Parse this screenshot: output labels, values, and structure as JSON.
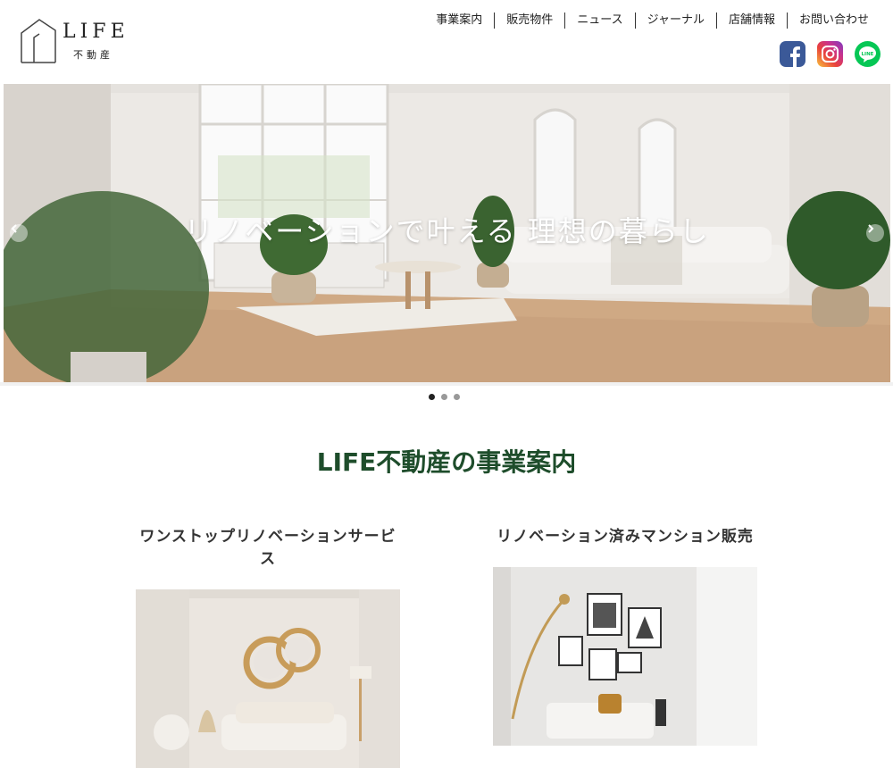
{
  "logo": {
    "word": "LIFE",
    "sub": "不動産"
  },
  "nav": [
    {
      "label": "事業案内"
    },
    {
      "label": "販売物件"
    },
    {
      "label": "ニュース"
    },
    {
      "label": "ジャーナル"
    },
    {
      "label": "店舗情報"
    },
    {
      "label": "お問い合わせ"
    }
  ],
  "social": [
    "facebook-icon",
    "instagram-icon",
    "line-icon"
  ],
  "hero": {
    "caption": "リノベーションで叶える 理想の暮らし",
    "slide_count": 3,
    "active_slide": 1
  },
  "section": {
    "title": "LIFE不動産の事業案内"
  },
  "cards": [
    {
      "title": "ワンストップリノベーションサービス"
    },
    {
      "title": "リノベーション済みマンション販売"
    }
  ],
  "colors": {
    "accent_green": "#1e4d2b",
    "facebook": "#3b5998",
    "line": "#06c755"
  }
}
